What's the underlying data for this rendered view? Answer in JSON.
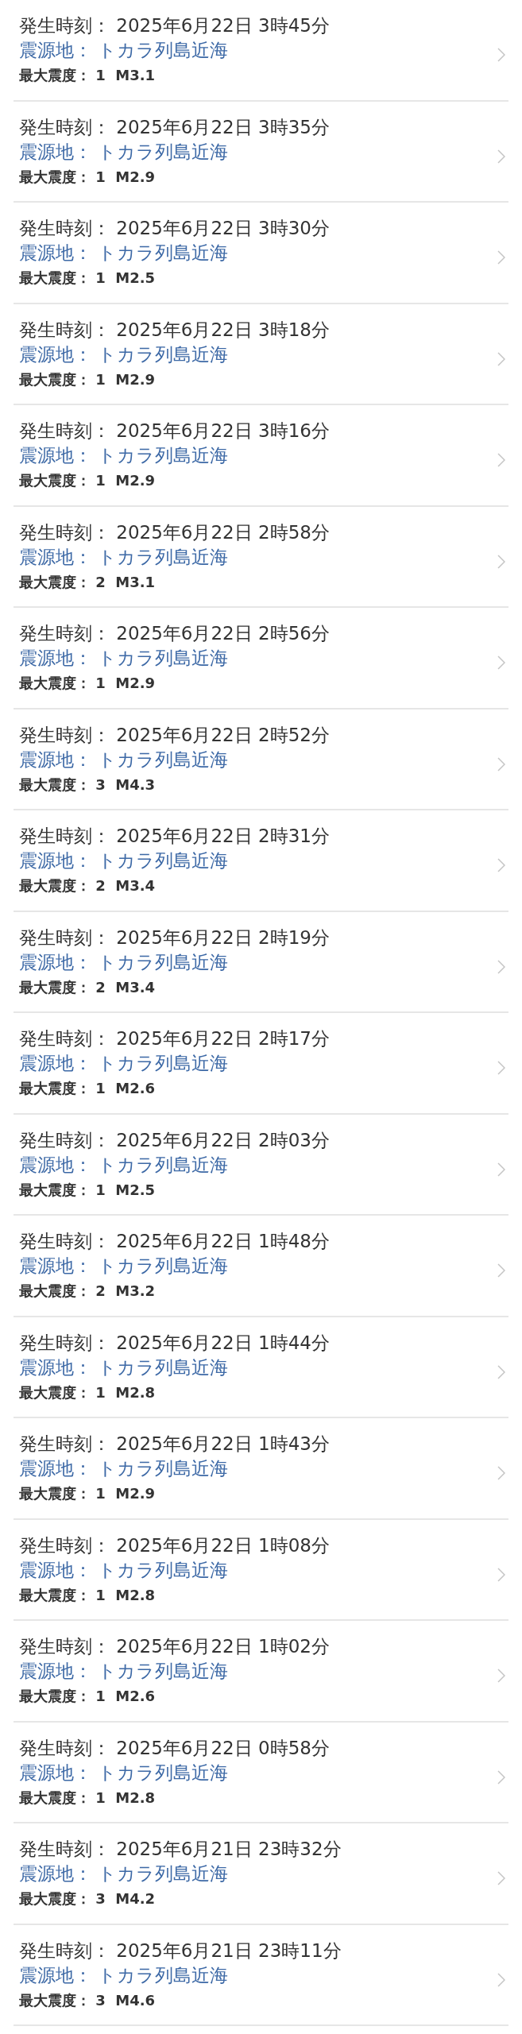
{
  "earthquakes": [
    {
      "time": "発生時刻： 2025年6月22日 3時45分",
      "epicenter": "震源地： トカラ列島近海",
      "intensity": "最大震度： 1  M3.1"
    },
    {
      "time": "発生時刻： 2025年6月22日 3時35分",
      "epicenter": "震源地： トカラ列島近海",
      "intensity": "最大震度： 1  M2.9"
    },
    {
      "time": "発生時刻： 2025年6月22日 3時30分",
      "epicenter": "震源地： トカラ列島近海",
      "intensity": "最大震度： 1  M2.5"
    },
    {
      "time": "発生時刻： 2025年6月22日 3時18分",
      "epicenter": "震源地： トカラ列島近海",
      "intensity": "最大震度： 1  M2.9"
    },
    {
      "time": "発生時刻： 2025年6月22日 3時16分",
      "epicenter": "震源地： トカラ列島近海",
      "intensity": "最大震度： 1  M2.9"
    },
    {
      "time": "発生時刻： 2025年6月22日 2時58分",
      "epicenter": "震源地： トカラ列島近海",
      "intensity": "最大震度： 2  M3.1"
    },
    {
      "time": "発生時刻： 2025年6月22日 2時56分",
      "epicenter": "震源地： トカラ列島近海",
      "intensity": "最大震度： 1  M2.9"
    },
    {
      "time": "発生時刻： 2025年6月22日 2時52分",
      "epicenter": "震源地： トカラ列島近海",
      "intensity": "最大震度： 3  M4.3"
    },
    {
      "time": "発生時刻： 2025年6月22日 2時31分",
      "epicenter": "震源地： トカラ列島近海",
      "intensity": "最大震度： 2  M3.4"
    },
    {
      "time": "発生時刻： 2025年6月22日 2時19分",
      "epicenter": "震源地： トカラ列島近海",
      "intensity": "最大震度： 2  M3.4"
    },
    {
      "time": "発生時刻： 2025年6月22日 2時17分",
      "epicenter": "震源地： トカラ列島近海",
      "intensity": "最大震度： 1  M2.6"
    },
    {
      "time": "発生時刻： 2025年6月22日 2時03分",
      "epicenter": "震源地： トカラ列島近海",
      "intensity": "最大震度： 1  M2.5"
    },
    {
      "time": "発生時刻： 2025年6月22日 1時48分",
      "epicenter": "震源地： トカラ列島近海",
      "intensity": "最大震度： 2  M3.2"
    },
    {
      "time": "発生時刻： 2025年6月22日 1時44分",
      "epicenter": "震源地： トカラ列島近海",
      "intensity": "最大震度： 1  M2.8"
    },
    {
      "time": "発生時刻： 2025年6月22日 1時43分",
      "epicenter": "震源地： トカラ列島近海",
      "intensity": "最大震度： 1  M2.9"
    },
    {
      "time": "発生時刻： 2025年6月22日 1時08分",
      "epicenter": "震源地： トカラ列島近海",
      "intensity": "最大震度： 1  M2.8"
    },
    {
      "time": "発生時刻： 2025年6月22日 1時02分",
      "epicenter": "震源地： トカラ列島近海",
      "intensity": "最大震度： 1  M2.6"
    },
    {
      "time": "発生時刻： 2025年6月22日 0時58分",
      "epicenter": "震源地： トカラ列島近海",
      "intensity": "最大震度： 1  M2.8"
    },
    {
      "time": "発生時刻： 2025年6月21日 23時32分",
      "epicenter": "震源地： トカラ列島近海",
      "intensity": "最大震度： 3  M4.2"
    },
    {
      "time": "発生時刻： 2025年6月21日 23時11分",
      "epicenter": "震源地： トカラ列島近海",
      "intensity": "最大震度： 3  M4.6"
    }
  ]
}
